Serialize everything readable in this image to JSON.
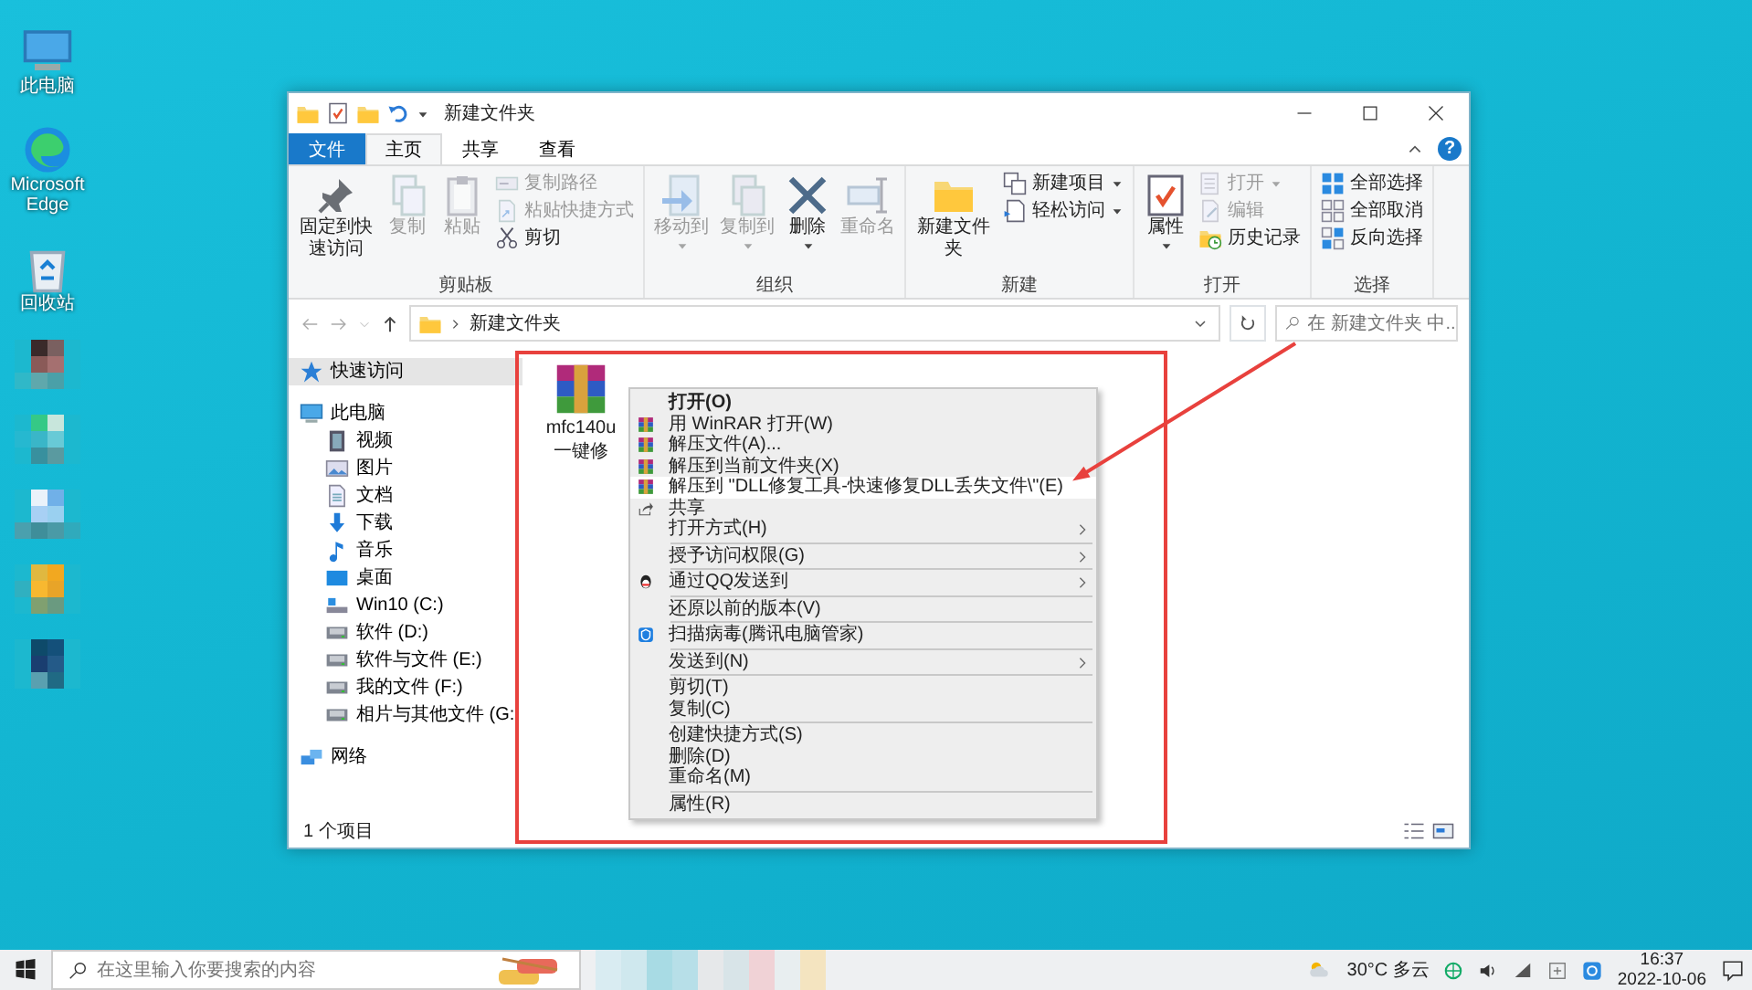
{
  "desktop_icons": [
    {
      "label": "此电脑",
      "kind": "pc"
    },
    {
      "label": "Microsoft Edge",
      "kind": "edge"
    },
    {
      "label": "回收站",
      "kind": "recycle"
    }
  ],
  "window": {
    "title": "新建文件夹",
    "tabs": [
      {
        "label": "文件",
        "kind": "file",
        "selected": false
      },
      {
        "label": "主页",
        "kind": "tab",
        "selected": true
      },
      {
        "label": "共享",
        "kind": "tab",
        "selected": false
      },
      {
        "label": "查看",
        "kind": "tab",
        "selected": false
      }
    ],
    "help": "?",
    "ribbon": [
      {
        "label": "剪贴板",
        "items": [
          {
            "label": "固定到快速访问",
            "kind": "large",
            "disabled": false,
            "dropdown": false
          },
          {
            "label": "复制",
            "kind": "large",
            "disabled": true,
            "dropdown": false
          },
          {
            "label": "粘贴",
            "kind": "large",
            "disabled": true,
            "dropdown": false
          },
          {
            "label": "复制路径",
            "kind": "small",
            "disabled": true,
            "dropdown": false
          },
          {
            "label": "粘贴快捷方式",
            "kind": "small",
            "disabled": true,
            "dropdown": false
          },
          {
            "label": "剪切",
            "kind": "small",
            "disabled": false,
            "dropdown": false
          }
        ]
      },
      {
        "label": "组织",
        "items": [
          {
            "label": "移动到",
            "kind": "large",
            "disabled": true,
            "dropdown": true
          },
          {
            "label": "复制到",
            "kind": "large",
            "disabled": true,
            "dropdown": true
          },
          {
            "label": "删除",
            "kind": "large",
            "disabled": false,
            "dropdown": true
          },
          {
            "label": "重命名",
            "kind": "large",
            "disabled": true,
            "dropdown": false
          }
        ]
      },
      {
        "label": "新建",
        "items": [
          {
            "label": "新建文件夹",
            "kind": "large",
            "disabled": false,
            "dropdown": false
          },
          {
            "label": "新建项目",
            "kind": "small",
            "disabled": false,
            "dropdown": true
          },
          {
            "label": "轻松访问",
            "kind": "small",
            "disabled": false,
            "dropdown": true
          }
        ]
      },
      {
        "label": "打开",
        "items": [
          {
            "label": "属性",
            "kind": "large",
            "disabled": false,
            "dropdown": true
          },
          {
            "label": "打开",
            "kind": "small",
            "disabled": true,
            "dropdown": true
          },
          {
            "label": "编辑",
            "kind": "small",
            "disabled": true,
            "dropdown": false
          },
          {
            "label": "历史记录",
            "kind": "small",
            "disabled": false,
            "dropdown": false
          }
        ]
      },
      {
        "label": "选择",
        "items": [
          {
            "label": "全部选择",
            "kind": "small",
            "disabled": false,
            "dropdown": false
          },
          {
            "label": "全部取消",
            "kind": "small",
            "disabled": false,
            "dropdown": false
          },
          {
            "label": "反向选择",
            "kind": "small",
            "disabled": false,
            "dropdown": false
          }
        ]
      }
    ],
    "address": {
      "path": "新建文件夹",
      "search_placeholder": "在 新建文件夹 中..."
    },
    "navigation": [
      {
        "label": "快速访问",
        "kind": "star",
        "selected": true
      },
      {
        "label": "此电脑",
        "kind": "pc",
        "selected": false,
        "children": [
          {
            "label": "视频",
            "kind": "video",
            "selected": false
          },
          {
            "label": "图片",
            "kind": "pictures",
            "selected": false
          },
          {
            "label": "文档",
            "kind": "documents",
            "selected": false
          },
          {
            "label": "下载",
            "kind": "download",
            "selected": false
          },
          {
            "label": "音乐",
            "kind": "music",
            "selected": false
          },
          {
            "label": "桌面",
            "kind": "desktop",
            "selected": false
          },
          {
            "label": "Win10 (C:)",
            "kind": "system-drive",
            "selected": false
          },
          {
            "label": "软件 (D:)",
            "kind": "drive",
            "selected": false
          },
          {
            "label": "软件与文件 (E:)",
            "kind": "drive",
            "selected": false
          },
          {
            "label": "我的文件 (F:)",
            "kind": "drive",
            "selected": false
          },
          {
            "label": "相片与其他文件 (G:",
            "kind": "drive",
            "selected": false
          }
        ]
      },
      {
        "label": "网络",
        "kind": "network",
        "selected": false
      }
    ],
    "files": [
      {
        "name_lines": [
          "mfc140u",
          "一键修"
        ],
        "kind": "archive"
      }
    ],
    "context_menu": [
      {
        "label": "打开(O)",
        "kind": "plain",
        "bold": true,
        "submenu": false,
        "selected": false
      },
      {
        "label": "用 WinRAR 打开(W)",
        "kind": "rar",
        "bold": false,
        "submenu": false,
        "selected": false
      },
      {
        "label": "解压文件(A)...",
        "kind": "rar",
        "bold": false,
        "submenu": false,
        "selected": false
      },
      {
        "label": "解压到当前文件夹(X)",
        "kind": "rar",
        "bold": false,
        "submenu": false,
        "selected": false
      },
      {
        "label": "解压到 \"DLL修复工具-快速修复DLL丢失文件\\\"(E)",
        "kind": "rar",
        "bold": false,
        "submenu": false,
        "selected": true
      },
      {
        "label": "共享",
        "kind": "share",
        "bold": false,
        "submenu": false,
        "selected": false
      },
      {
        "label": "打开方式(H)",
        "kind": "plain",
        "bold": false,
        "submenu": true,
        "selected": false
      },
      {
        "kind": "separator"
      },
      {
        "label": "授予访问权限(G)",
        "kind": "plain",
        "bold": false,
        "submenu": true,
        "selected": false
      },
      {
        "kind": "separator"
      },
      {
        "label": "通过QQ发送到",
        "kind": "qq",
        "bold": false,
        "submenu": true,
        "selected": false
      },
      {
        "kind": "separator"
      },
      {
        "label": "还原以前的版本(V)",
        "kind": "plain",
        "bold": false,
        "submenu": false,
        "selected": false
      },
      {
        "kind": "separator"
      },
      {
        "label": "扫描病毒(腾讯电脑管家)",
        "kind": "guard",
        "bold": false,
        "submenu": false,
        "selected": false
      },
      {
        "kind": "separator"
      },
      {
        "label": "发送到(N)",
        "kind": "plain",
        "bold": false,
        "submenu": true,
        "selected": false
      },
      {
        "kind": "separator"
      },
      {
        "label": "剪切(T)",
        "kind": "plain",
        "bold": false,
        "submenu": false,
        "selected": false
      },
      {
        "label": "复制(C)",
        "kind": "plain",
        "bold": false,
        "submenu": false,
        "selected": false
      },
      {
        "kind": "separator"
      },
      {
        "label": "创建快捷方式(S)",
        "kind": "plain",
        "bold": false,
        "submenu": false,
        "selected": false
      },
      {
        "label": "删除(D)",
        "kind": "plain",
        "bold": false,
        "submenu": false,
        "selected": false
      },
      {
        "label": "重命名(M)",
        "kind": "plain",
        "bold": false,
        "submenu": false,
        "selected": false
      },
      {
        "kind": "separator"
      },
      {
        "label": "属性(R)",
        "kind": "plain",
        "bold": false,
        "submenu": false,
        "selected": false
      }
    ],
    "status_bar": {
      "count": "1 个项目"
    }
  },
  "taskbar": {
    "search_placeholder": "在这里输入你要搜索的内容",
    "weather": "30°C 多云",
    "time": "16:37",
    "date": "2022-10-06"
  }
}
